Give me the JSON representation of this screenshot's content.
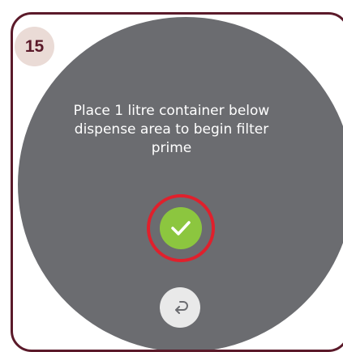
{
  "step": {
    "number": "15"
  },
  "instruction": {
    "line1": "Place 1 litre container below",
    "line2": "dispense area to begin filter",
    "line3": "prime"
  },
  "controls": {
    "confirm_icon": "check-icon",
    "back_icon": "return-arrow-icon"
  },
  "colors": {
    "frame": "#5b1a2a",
    "screen": "#6b6c70",
    "confirm": "#8cc63f",
    "highlight_ring": "#e0202c",
    "badge_bg": "#eadbd6"
  }
}
